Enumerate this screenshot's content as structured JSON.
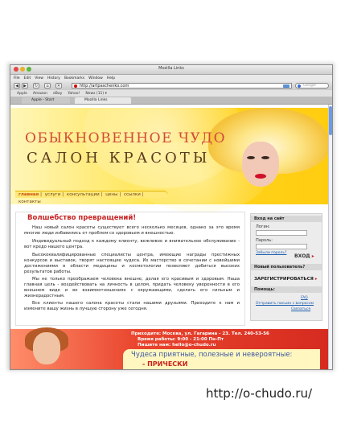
{
  "window": {
    "title": "Mozilla Links"
  },
  "menubar": [
    "File",
    "Edit",
    "View",
    "History",
    "Bookmarks",
    "Window",
    "Help"
  ],
  "navigation": {
    "back_icon": "back-arrow-icon",
    "forward_icon": "forward-arrow-icon",
    "reload_icon": "reload-icon",
    "home_icon": "home-icon",
    "url": "http://artpaschenko.com",
    "search_placeholder": "Google"
  },
  "bookmarks": [
    "Apple",
    "Amazon",
    "eBay",
    "Yahoo!",
    "News (11) ▾"
  ],
  "tabs": [
    {
      "label": "Apple - Start"
    },
    {
      "label": "Mozilla Links"
    }
  ],
  "site": {
    "title_line1": "ОБЫКНОВЕННОЕ ЧУДО",
    "title_line2": "САЛОН КРАСОТЫ",
    "nav": [
      "главная",
      "услуги",
      "консультации",
      "цены",
      "ссылки",
      "контакты"
    ],
    "welcome": "Волшебство превращений!",
    "paragraphs": [
      "Наш новый салон красоты существует всего несколько месяцев, однако за это время многие люди избавились от проблем со здоровьем и внешностью.",
      "Индивидуальный подход к каждому клиенту, вежливое и внимательное обслуживание - вот кредо нашего центра.",
      "Высококвалифицированные специалисты центра, имеющие награды престижных конкурсов и выставок, творят настоящие чудеса. Их мастерство в сочетании с новейшими достижениями в области медицины и косметологии позволяют добиться высоких результатов работы.",
      "Мы не только преображаем человека внешне, делая его красивым и здоровым. Наша главная цель - воздействовать на личность в целом, придать человеку уверенности в его внешнем виде и во взаимоотношениях с окружающими, сделать его сильным и жизнерадостным.",
      "Все клиенты нашего салона красоты стали нашими друзьями. Приходите к нам и измените вашу жизнь в лучшую сторону уже сегодня."
    ],
    "sidebar": {
      "login_header": "Вход на сайт",
      "login_label": "Логин:",
      "password_label": "Пароль:",
      "forgot_link": "Забыли пароль?",
      "login_button": "ВХОД",
      "new_user_header": "Новый пользователь?",
      "register_link": "ЗАРЕГИСТРИРОВАТЬСЯ",
      "help_header": "Помощь:",
      "faq_link": "FAQ",
      "question_link": "Отправить письмо с вопросом",
      "contacts_link": "Связаться"
    },
    "footer": {
      "address": "Приходите: Москва, ул. Гагарина - 23. Тел. 240-53-56",
      "hours": "Время работы: 9:00 - 21:00 Пн-Пт",
      "email": "Пишите нам: hello@o-chudo.ru",
      "slogan": "Чудеса приятные, полезные и невероятные:",
      "item": "- ПРИЧЕСКИ"
    }
  },
  "caption": "http://o-chudo.ru/",
  "colors": {
    "banner_yellow": "#ffd21a",
    "title_red": "#d24a3a",
    "welcome_red": "#c72323",
    "footer_red": "#d62b20",
    "link_blue": "#2060b0"
  }
}
